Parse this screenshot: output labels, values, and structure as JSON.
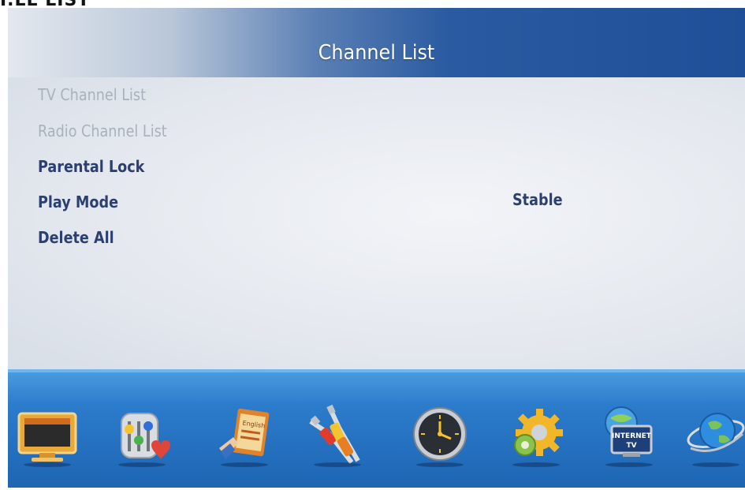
{
  "corner_label": "I.LL LIST",
  "header": {
    "title": "Channel List"
  },
  "menu": {
    "items": [
      {
        "label": "TV Channel List"
      },
      {
        "label": "Radio Channel List"
      },
      {
        "label": "Parental Lock"
      },
      {
        "label": "Play Mode"
      },
      {
        "label": "Delete All"
      }
    ],
    "play_mode_value": "Stable"
  },
  "toolbar": {
    "icons": [
      "tv-monitor-icon",
      "audio-settings-icon",
      "language-icon",
      "av-cables-icon",
      "clock-icon",
      "gear-icon",
      "internet-tv-icon",
      "globe-icon"
    ],
    "internet_tv_label_1": "INTERNET",
    "internet_tv_label_2": "TV",
    "language_sign": "English"
  },
  "colors": {
    "header_dark": "#1f4f98",
    "content_bg": "#e5e9ef",
    "text_active": "#2b3f70",
    "text_dim": "#a9b1bd",
    "toolbar_bg": "#1d65b3"
  }
}
